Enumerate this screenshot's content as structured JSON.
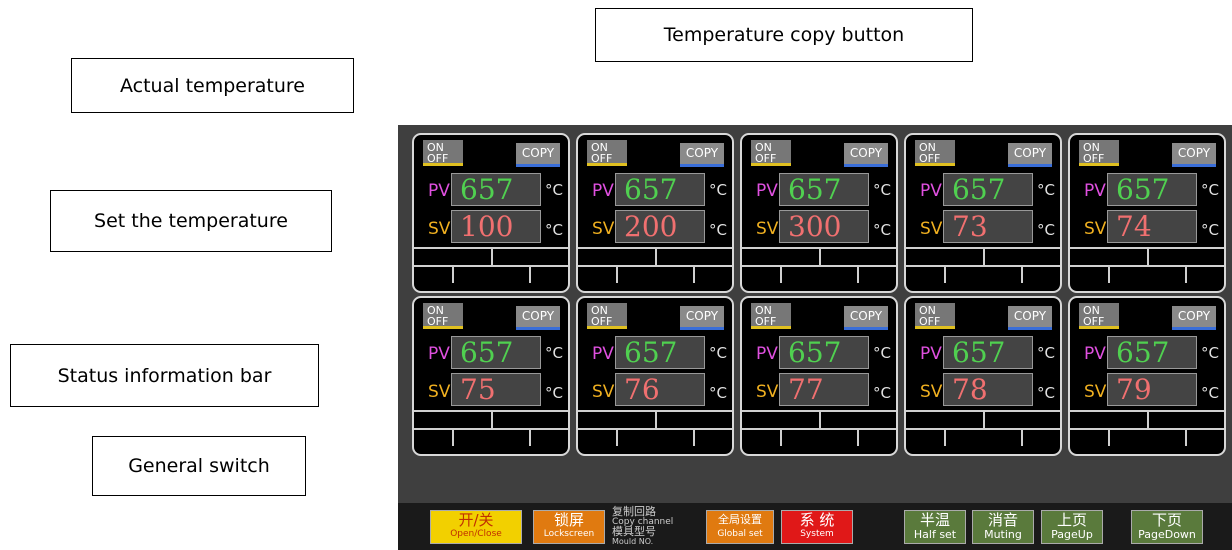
{
  "callouts": {
    "copy_button": "Temperature copy button",
    "actual": "Actual temperature",
    "set": "Set the temperature",
    "status": "Status information bar",
    "switch": "General switch"
  },
  "channel_labels": {
    "on": "ON",
    "off": "OFF",
    "copy": "COPY",
    "pv": "PV",
    "sv": "SV",
    "unit": "°C"
  },
  "channels": [
    {
      "pv": "657",
      "sv": "100"
    },
    {
      "pv": "657",
      "sv": "200"
    },
    {
      "pv": "657",
      "sv": "300"
    },
    {
      "pv": "657",
      "sv": "73"
    },
    {
      "pv": "657",
      "sv": "74"
    },
    {
      "pv": "657",
      "sv": "75"
    },
    {
      "pv": "657",
      "sv": "76"
    },
    {
      "pv": "657",
      "sv": "77"
    },
    {
      "pv": "657",
      "sv": "78"
    },
    {
      "pv": "657",
      "sv": "79"
    }
  ],
  "bottom": {
    "open_close": {
      "zh": "开/关",
      "en": "Open/Close"
    },
    "lockscreen": {
      "zh": "锁屏",
      "en": "Lockscreen"
    },
    "copy_label": {
      "zh": "复制回路",
      "en": "Copy channel"
    },
    "mould_label": {
      "zh": "模具型号",
      "en": "Mould NO."
    },
    "global_set": {
      "zh": "全局设置",
      "en": "Global set"
    },
    "system": {
      "zh": "系 统",
      "en": "System"
    },
    "half_set": {
      "zh": "半温",
      "en": "Half set"
    },
    "muting": {
      "zh": "消音",
      "en": "Muting"
    },
    "page_up": {
      "zh": "上页",
      "en": "PageUp"
    },
    "page_down": {
      "zh": "下页",
      "en": "PageDown"
    }
  },
  "colors": {
    "pv": "#50d050",
    "sv": "#f07070",
    "on_off_accent": "#e0c020",
    "copy_accent": "#3a6ed8"
  }
}
